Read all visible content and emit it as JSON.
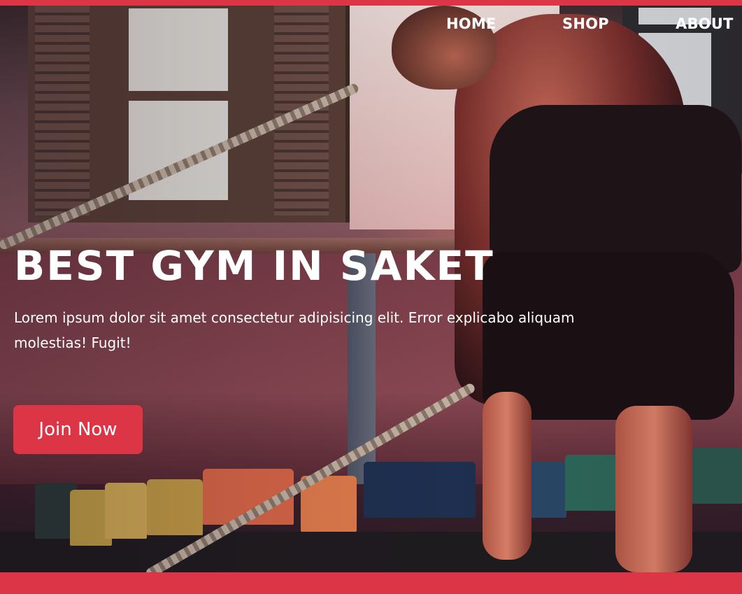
{
  "nav": {
    "items": [
      {
        "label": "HOME"
      },
      {
        "label": "SHOP"
      },
      {
        "label": "ABOUT"
      }
    ]
  },
  "hero": {
    "headline": "BEST GYM IN SAKET",
    "subtext": "Lorem ipsum dolor sit amet consectetur adipisicing elit. Error explicabo aliquam molestias! Fugit!",
    "cta_label": "Join Now",
    "background_image": "man-training-with-battle-ropes-in-gym"
  },
  "colors": {
    "accent": "#dc3545",
    "text": "#ffffff"
  }
}
